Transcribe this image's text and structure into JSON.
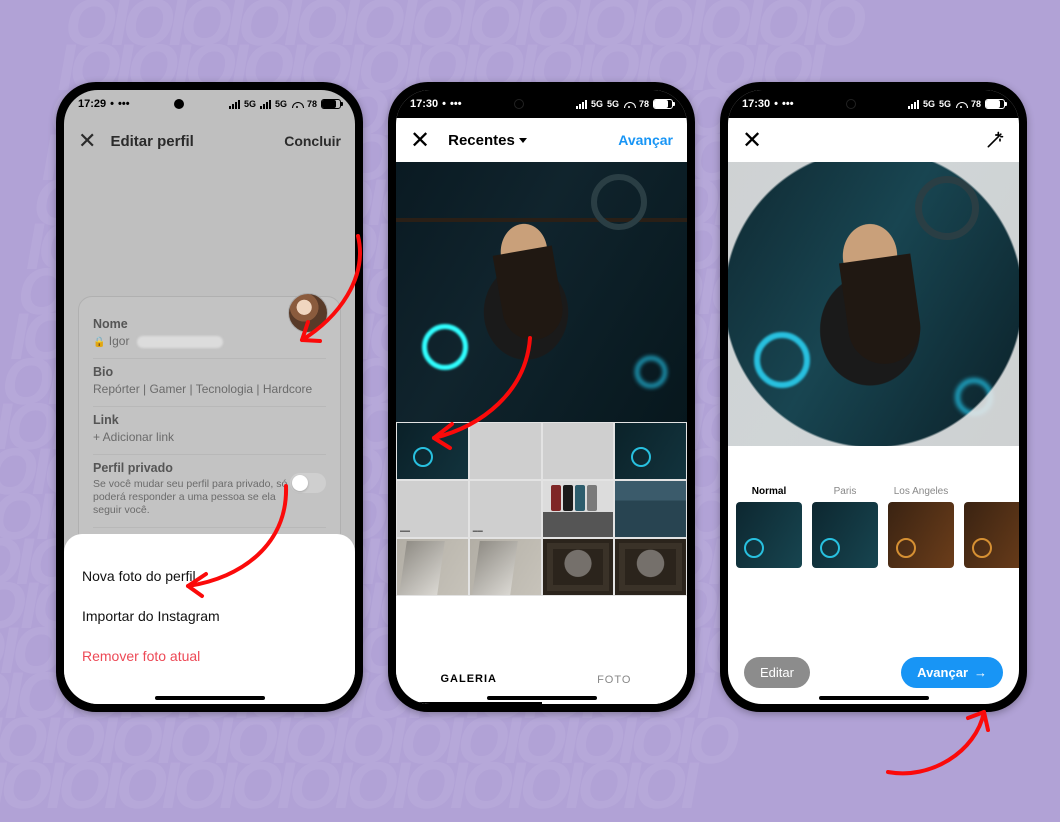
{
  "status": {
    "time1": "17:29",
    "time2": "17:30",
    "time3": "17:30",
    "net": "5G",
    "battery": "78"
  },
  "phone1": {
    "title": "Editar perfil",
    "done": "Concluir",
    "form": {
      "name_label": "Nome",
      "name_value": "Igor",
      "bio_label": "Bio",
      "bio_value": "Repórter | Gamer | Tecnologia | Hardcore",
      "link_label": "Link",
      "link_placeholder": "+ Adicionar link",
      "private_label": "Perfil privado",
      "private_desc": "Se você mudar seu perfil para privado, só poderá responder a uma pessoa se ela seguir você."
    },
    "sheet": {
      "new": "Nova foto do perfil",
      "import": "Importar do Instagram",
      "remove": "Remover foto atual"
    }
  },
  "phone2": {
    "back": "✕",
    "dropdown": "Recentes",
    "next": "Avançar",
    "tabs": {
      "gallery": "GALERIA",
      "photo": "FOTO"
    }
  },
  "phone3": {
    "filters": [
      "Normal",
      "Paris",
      "Los Angeles",
      ""
    ],
    "edit": "Editar",
    "next": "Avançar"
  },
  "arrow_icon_label": "hand-drawn-arrow"
}
